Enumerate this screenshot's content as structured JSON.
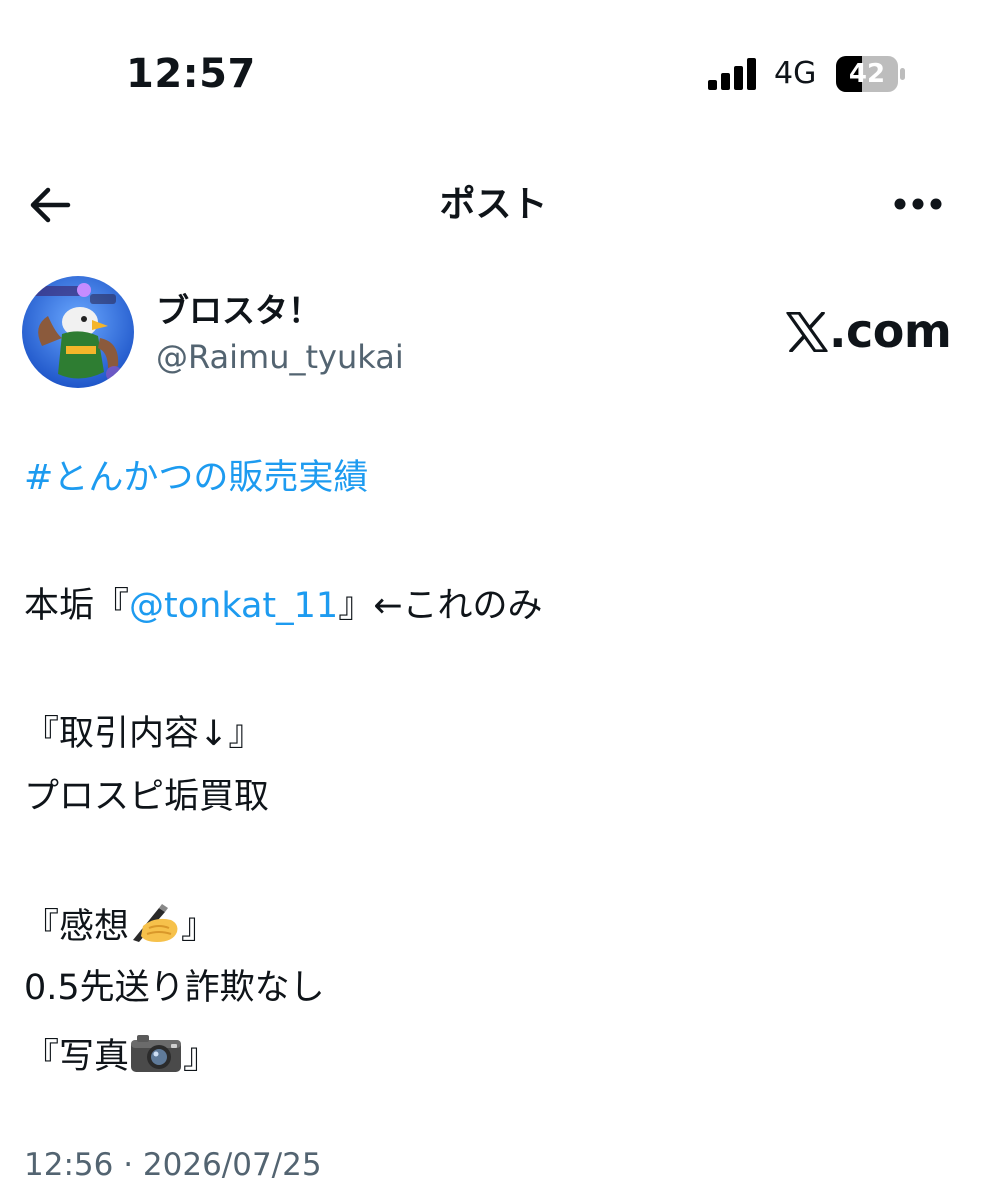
{
  "status_bar": {
    "time": "12:57",
    "network": "4G",
    "battery": "42",
    "icons": [
      "signal-icon",
      "battery-icon"
    ]
  },
  "header": {
    "title": "ポスト",
    "back_icon": "arrow-left-icon",
    "more_icon": "more-horizontal-icon"
  },
  "author": {
    "display_name": "ブロスタ！",
    "handle": "@Raimu_tyukai",
    "watermark": "𝕏.com"
  },
  "post": {
    "hashtag": "#とんかつの販売実績",
    "line_main_prefix": "本垢『",
    "mention": "@tonkat_11",
    "line_main_suffix": "』←これのみ",
    "trade_heading": "『取引内容↓』",
    "trade_detail": "プロスピ垢買取",
    "impression_prefix": "『感想",
    "impression_suffix": "』",
    "impression_detail": "0.5先送り詐欺なし",
    "photo_prefix": "『写真",
    "photo_suffix": "』"
  },
  "timestamp": "12:56 · 2026/07/25",
  "colors": {
    "link": "#1d9bf0",
    "text": "#0f1419",
    "secondary": "#536471"
  }
}
